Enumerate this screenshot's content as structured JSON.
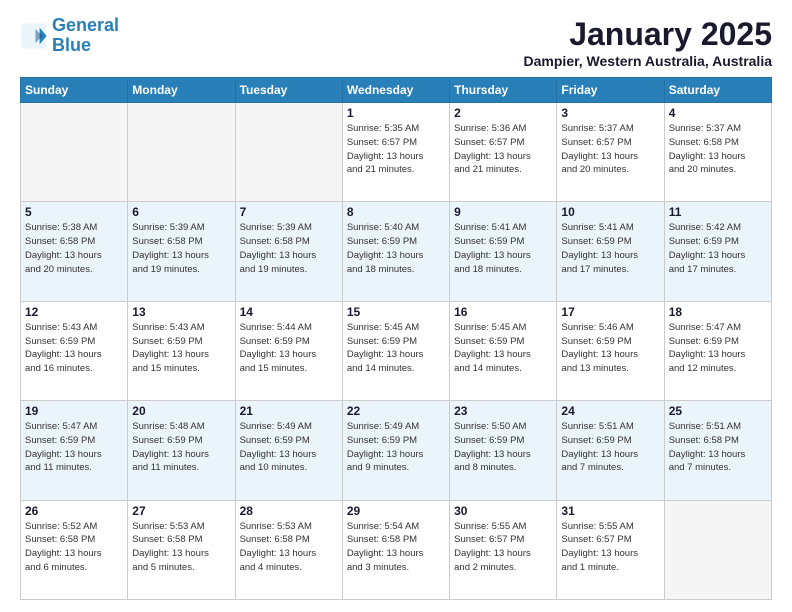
{
  "header": {
    "logo_line1": "General",
    "logo_line2": "Blue",
    "month": "January 2025",
    "location": "Dampier, Western Australia, Australia"
  },
  "weekdays": [
    "Sunday",
    "Monday",
    "Tuesday",
    "Wednesday",
    "Thursday",
    "Friday",
    "Saturday"
  ],
  "weeks": [
    [
      {
        "day": "",
        "info": ""
      },
      {
        "day": "",
        "info": ""
      },
      {
        "day": "",
        "info": ""
      },
      {
        "day": "1",
        "info": "Sunrise: 5:35 AM\nSunset: 6:57 PM\nDaylight: 13 hours\nand 21 minutes."
      },
      {
        "day": "2",
        "info": "Sunrise: 5:36 AM\nSunset: 6:57 PM\nDaylight: 13 hours\nand 21 minutes."
      },
      {
        "day": "3",
        "info": "Sunrise: 5:37 AM\nSunset: 6:57 PM\nDaylight: 13 hours\nand 20 minutes."
      },
      {
        "day": "4",
        "info": "Sunrise: 5:37 AM\nSunset: 6:58 PM\nDaylight: 13 hours\nand 20 minutes."
      }
    ],
    [
      {
        "day": "5",
        "info": "Sunrise: 5:38 AM\nSunset: 6:58 PM\nDaylight: 13 hours\nand 20 minutes."
      },
      {
        "day": "6",
        "info": "Sunrise: 5:39 AM\nSunset: 6:58 PM\nDaylight: 13 hours\nand 19 minutes."
      },
      {
        "day": "7",
        "info": "Sunrise: 5:39 AM\nSunset: 6:58 PM\nDaylight: 13 hours\nand 19 minutes."
      },
      {
        "day": "8",
        "info": "Sunrise: 5:40 AM\nSunset: 6:59 PM\nDaylight: 13 hours\nand 18 minutes."
      },
      {
        "day": "9",
        "info": "Sunrise: 5:41 AM\nSunset: 6:59 PM\nDaylight: 13 hours\nand 18 minutes."
      },
      {
        "day": "10",
        "info": "Sunrise: 5:41 AM\nSunset: 6:59 PM\nDaylight: 13 hours\nand 17 minutes."
      },
      {
        "day": "11",
        "info": "Sunrise: 5:42 AM\nSunset: 6:59 PM\nDaylight: 13 hours\nand 17 minutes."
      }
    ],
    [
      {
        "day": "12",
        "info": "Sunrise: 5:43 AM\nSunset: 6:59 PM\nDaylight: 13 hours\nand 16 minutes."
      },
      {
        "day": "13",
        "info": "Sunrise: 5:43 AM\nSunset: 6:59 PM\nDaylight: 13 hours\nand 15 minutes."
      },
      {
        "day": "14",
        "info": "Sunrise: 5:44 AM\nSunset: 6:59 PM\nDaylight: 13 hours\nand 15 minutes."
      },
      {
        "day": "15",
        "info": "Sunrise: 5:45 AM\nSunset: 6:59 PM\nDaylight: 13 hours\nand 14 minutes."
      },
      {
        "day": "16",
        "info": "Sunrise: 5:45 AM\nSunset: 6:59 PM\nDaylight: 13 hours\nand 14 minutes."
      },
      {
        "day": "17",
        "info": "Sunrise: 5:46 AM\nSunset: 6:59 PM\nDaylight: 13 hours\nand 13 minutes."
      },
      {
        "day": "18",
        "info": "Sunrise: 5:47 AM\nSunset: 6:59 PM\nDaylight: 13 hours\nand 12 minutes."
      }
    ],
    [
      {
        "day": "19",
        "info": "Sunrise: 5:47 AM\nSunset: 6:59 PM\nDaylight: 13 hours\nand 11 minutes."
      },
      {
        "day": "20",
        "info": "Sunrise: 5:48 AM\nSunset: 6:59 PM\nDaylight: 13 hours\nand 11 minutes."
      },
      {
        "day": "21",
        "info": "Sunrise: 5:49 AM\nSunset: 6:59 PM\nDaylight: 13 hours\nand 10 minutes."
      },
      {
        "day": "22",
        "info": "Sunrise: 5:49 AM\nSunset: 6:59 PM\nDaylight: 13 hours\nand 9 minutes."
      },
      {
        "day": "23",
        "info": "Sunrise: 5:50 AM\nSunset: 6:59 PM\nDaylight: 13 hours\nand 8 minutes."
      },
      {
        "day": "24",
        "info": "Sunrise: 5:51 AM\nSunset: 6:59 PM\nDaylight: 13 hours\nand 7 minutes."
      },
      {
        "day": "25",
        "info": "Sunrise: 5:51 AM\nSunset: 6:58 PM\nDaylight: 13 hours\nand 7 minutes."
      }
    ],
    [
      {
        "day": "26",
        "info": "Sunrise: 5:52 AM\nSunset: 6:58 PM\nDaylight: 13 hours\nand 6 minutes."
      },
      {
        "day": "27",
        "info": "Sunrise: 5:53 AM\nSunset: 6:58 PM\nDaylight: 13 hours\nand 5 minutes."
      },
      {
        "day": "28",
        "info": "Sunrise: 5:53 AM\nSunset: 6:58 PM\nDaylight: 13 hours\nand 4 minutes."
      },
      {
        "day": "29",
        "info": "Sunrise: 5:54 AM\nSunset: 6:58 PM\nDaylight: 13 hours\nand 3 minutes."
      },
      {
        "day": "30",
        "info": "Sunrise: 5:55 AM\nSunset: 6:57 PM\nDaylight: 13 hours\nand 2 minutes."
      },
      {
        "day": "31",
        "info": "Sunrise: 5:55 AM\nSunset: 6:57 PM\nDaylight: 13 hours\nand 1 minute."
      },
      {
        "day": "",
        "info": ""
      }
    ]
  ]
}
